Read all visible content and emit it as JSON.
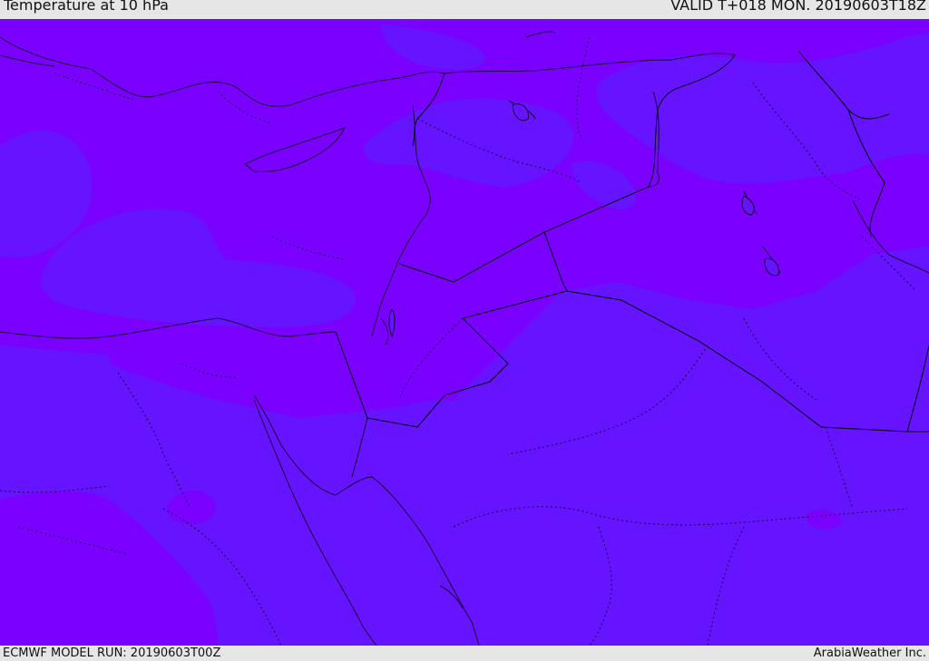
{
  "header": {
    "title": "Temperature at 10 hPa",
    "valid": "VALID T+018 MON. 20190603T18Z"
  },
  "footer": {
    "model_run": "ECMWF MODEL RUN: 20190603T00Z",
    "credit": "ArabiaWeather Inc."
  },
  "colors": {
    "warm_shade": "#7a00ff",
    "cool_shade": "#6614ff",
    "coastline": "#1a0033",
    "border": "#000000",
    "background": "#e6e6e6"
  }
}
